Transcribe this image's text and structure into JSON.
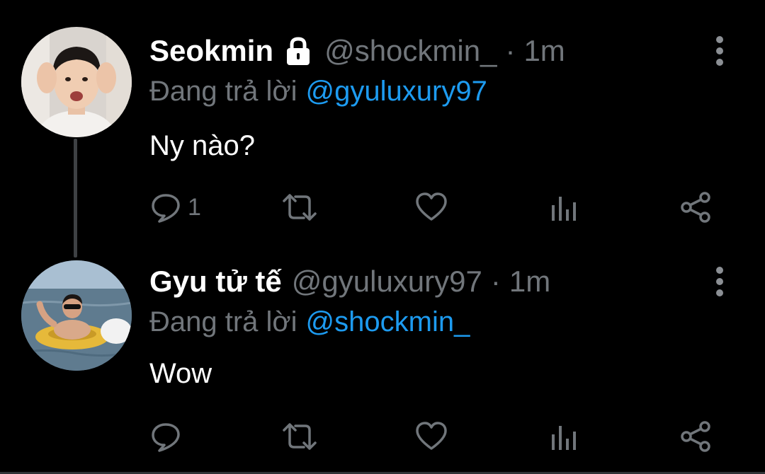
{
  "tweets": [
    {
      "display_name": "Seokmin",
      "protected": true,
      "handle": "@shockmin_",
      "separator": "·",
      "time": "1m",
      "reply_prefix": "Đang trả lời",
      "reply_to": "@gyuluxury97",
      "text": "Ny nào?",
      "actions": {
        "reply_count": "1",
        "retweet_count": "",
        "like_count": ""
      }
    },
    {
      "display_name": "Gyu tử tế",
      "protected": false,
      "handle": "@gyuluxury97",
      "separator": "·",
      "time": "1m",
      "reply_prefix": "Đang trả lời",
      "reply_to": "@shockmin_",
      "text": "Wow",
      "actions": {
        "reply_count": "",
        "retweet_count": "",
        "like_count": ""
      }
    }
  ],
  "icons": {
    "lock": "lock-icon",
    "more": "more-vertical-icon",
    "reply": "reply-icon",
    "retweet": "retweet-icon",
    "like": "heart-icon",
    "analytics": "analytics-icon",
    "share": "share-icon"
  },
  "colors": {
    "background": "#000000",
    "name": "#ffffff",
    "secondary": "#71767b",
    "link": "#1d9bf0",
    "thread_line": "#3e4144"
  }
}
